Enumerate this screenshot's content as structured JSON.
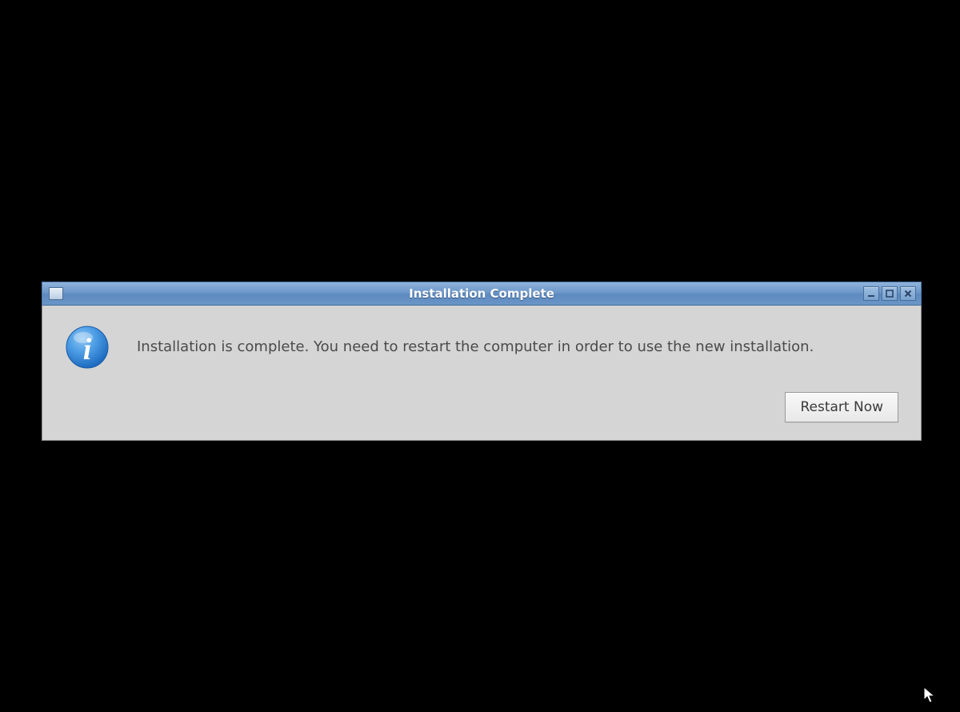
{
  "dialog": {
    "title": "Installation Complete",
    "message": "Installation is complete. You need to restart the computer in order to use the new installation.",
    "restart_label": "Restart Now"
  },
  "icons": {
    "info": "info-icon",
    "window_menu": "window-menu-icon",
    "minimize": "minimize-icon",
    "maximize": "maximize-icon",
    "close": "close-icon"
  }
}
